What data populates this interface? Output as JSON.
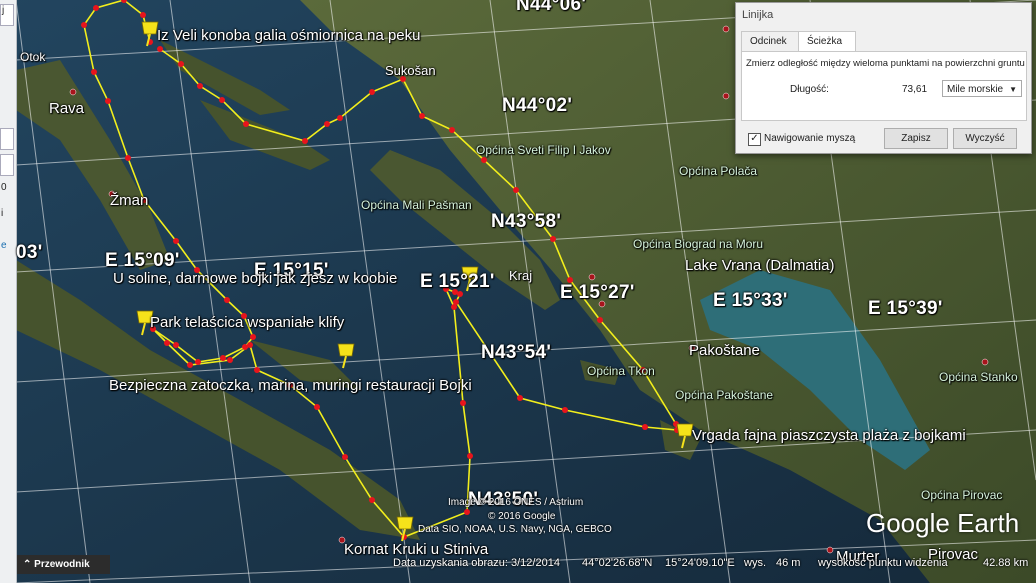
{
  "left_panel": {
    "chars": [
      "j",
      "0",
      "i",
      "e"
    ],
    "place_labels": [
      "Otok",
      "03'"
    ]
  },
  "place_labels": {
    "rava": "Rava",
    "zman": "Žman",
    "sukosan": "Sukošan",
    "kraj": "Kraj",
    "lake_vrana": "Lake Vrana (Dalmatia)",
    "pakostane": "Pakoštane",
    "pirovac": "Pirovac",
    "muster": "Murter"
  },
  "municipality_labels": {
    "sveti_filip": "Općina Sveti Filip I Jakov",
    "polaca": "Općina Polača",
    "mali_pasman": "Općina Mali Pašman",
    "biograd": "Općina Biograd na Moru",
    "tkon": "Općina Tkon",
    "pakostane": "Općina Pakoštane",
    "pirovac": "Općina Pirovac",
    "stankovci": "Općina Stanko"
  },
  "grid_labels": {
    "n44_06": "N44°06'",
    "n44_02": "N44°02'",
    "n43_58": "N43°58'",
    "n43_54": "N43°54'",
    "n43_50": "N43°50'",
    "e15_09": "E 15°09'",
    "e15_15": "E 15°15'",
    "e15_21": "E 15°21'",
    "e15_27": "E 15°27'",
    "e15_33": "E 15°33'",
    "e15_39": "E 15°39'"
  },
  "placemarks": [
    {
      "id": "iz-veli",
      "label": "Iz Veli konoba galia ośmiornica na peku"
    },
    {
      "id": "u-soline",
      "label": "U soline, darmowe bojki jak zjesz w koobie"
    },
    {
      "id": "telascica",
      "label": "Park telaścica wspaniałe klify"
    },
    {
      "id": "zatoczka",
      "label": "Bezpieczna zatoczka, marina, muringi restauracji Bojki"
    },
    {
      "id": "vrgada",
      "label": "Vrgada fajna piaszczysta plaża z bojkami"
    },
    {
      "id": "kornat",
      "label": "Kornat Kruki u Stiniva"
    }
  ],
  "ruler": {
    "title": "Linijka",
    "tabs": [
      {
        "label": "Odcinek",
        "active": false
      },
      {
        "label": "Ścieżka",
        "active": true
      }
    ],
    "description": "Zmierz odległość między wieloma punktami na powierzchni gruntu",
    "length_label": "Długość:",
    "length_value": "73,61",
    "unit": "Mile morskie",
    "mouse_nav_label": "Nawigowanie myszą",
    "mouse_nav_checked": true,
    "save_label": "Zapisz",
    "clear_label": "Wyczyść"
  },
  "credits": {
    "image_credit": "Image © 2016 CNES / Astrium",
    "google_credit": "© 2016 Google",
    "data_credit": "Data SIO, NOAA, U.S. Navy, NGA, GEBCO",
    "logo": "Google Earth"
  },
  "status_bar": {
    "guide_label": "Przewodnik",
    "imagery_date": "Data uzyskania obrazu: 3/12/2014",
    "latitude": "44°02'26.68\"N",
    "longitude": "15°24'09.10\"E",
    "elevation_label": "wys.",
    "elevation": "46 m",
    "eye_alt_label": "wysokość punktu widzenia",
    "eye_alt": "42.88 km"
  },
  "colors": {
    "path": "#f2ee1c",
    "vertex": "#e8141c",
    "pin": "#f5e21a",
    "sea": "#1f3f5a",
    "land": "#4d5b33"
  }
}
